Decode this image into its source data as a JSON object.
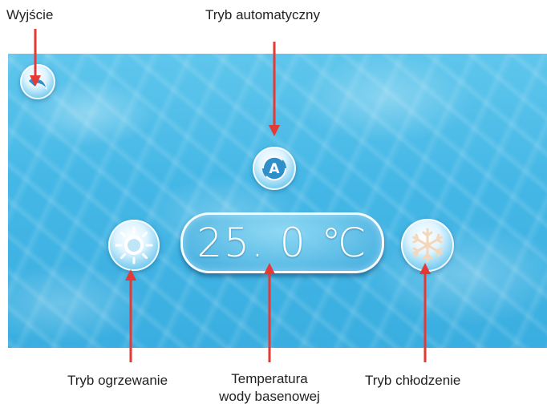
{
  "annotations": {
    "exit": "Wyjście",
    "auto_mode": "Tryb automatyczny",
    "heating_mode": "Tryb ogrzewanie",
    "water_temp_line1": "Temperatura",
    "water_temp_line2": "wody basenowej",
    "cooling_mode": "Tryb chłodzenie"
  },
  "panel": {
    "temperature": "25. 0 ℃",
    "auto_button_glyph": "A"
  },
  "icons": {
    "back": "back-arrow-icon",
    "auto": "auto-mode-icon",
    "heat": "sun-icon",
    "cool": "snowflake-icon"
  },
  "colors": {
    "annotation_arrow": "#e53935",
    "water": "#44b7e6"
  }
}
